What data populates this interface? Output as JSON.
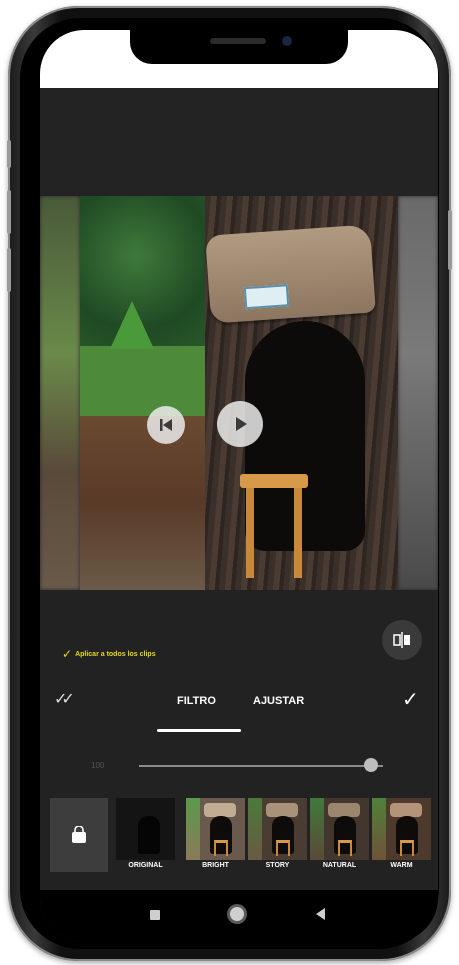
{
  "editor": {
    "apply_all_label": "Aplicar a todos los clips",
    "compare_icon": "compare-split-icon",
    "tabs": [
      {
        "label": "FILTRO",
        "active": true
      },
      {
        "label": "AJUSTAR",
        "active": false
      }
    ],
    "slider": {
      "label": "100",
      "value_fraction": 0.95
    },
    "filters": [
      {
        "label": "ORIGINAL"
      },
      {
        "label": "BRIGHT"
      },
      {
        "label": "STORY"
      },
      {
        "label": "NATURAL"
      },
      {
        "label": "WARM"
      }
    ]
  },
  "colors": {
    "accent": "#e5d81a",
    "background": "#222222",
    "navbar": "#000000"
  }
}
